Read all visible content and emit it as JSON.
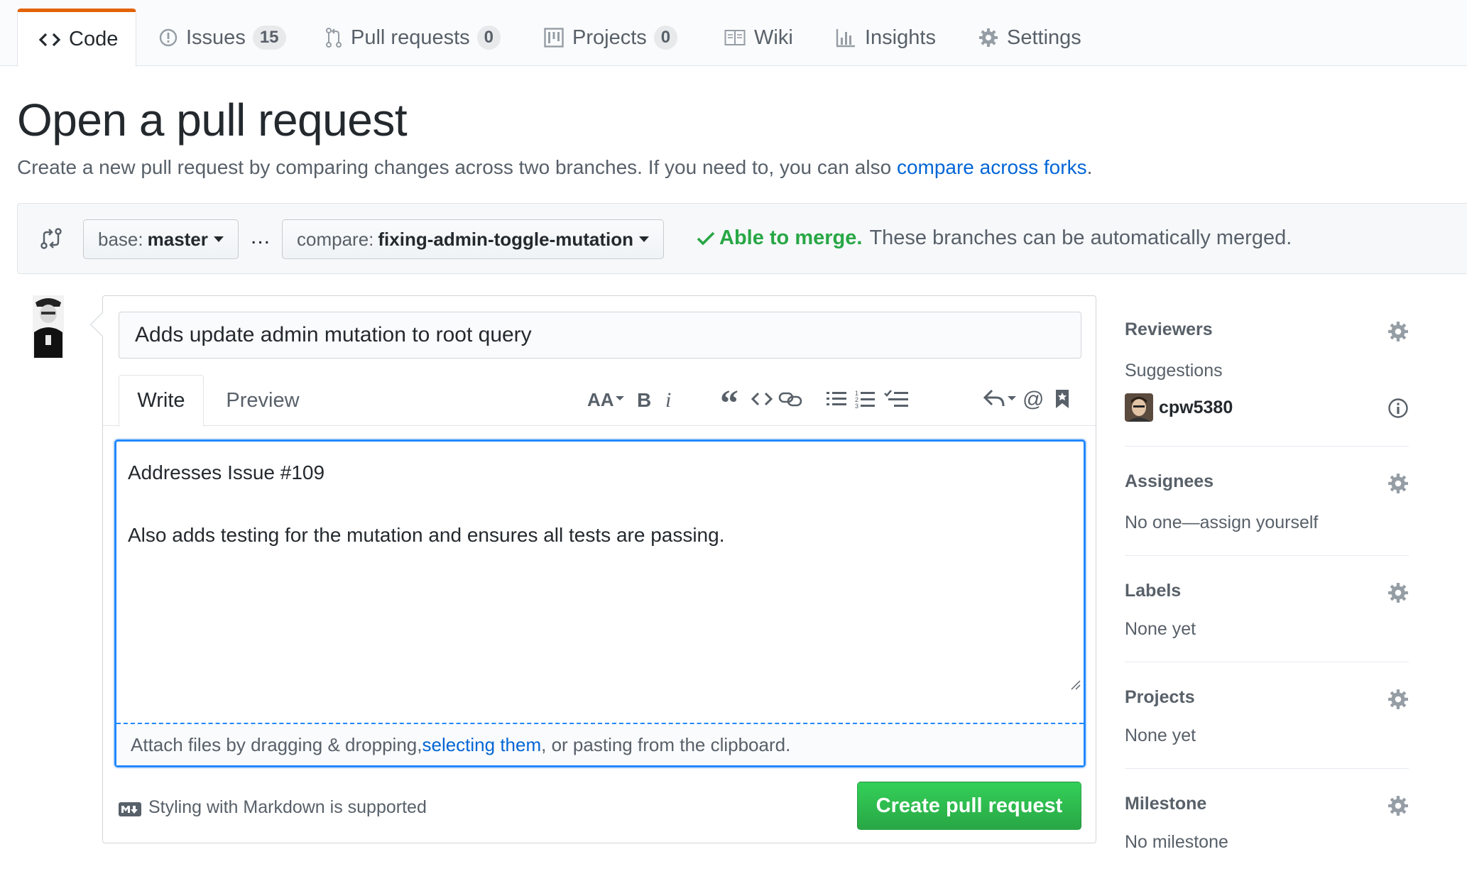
{
  "nav": {
    "tabs": [
      {
        "label": "Code"
      },
      {
        "label": "Issues",
        "count": "15"
      },
      {
        "label": "Pull requests",
        "count": "0"
      },
      {
        "label": "Projects",
        "count": "0"
      },
      {
        "label": "Wiki"
      },
      {
        "label": "Insights"
      },
      {
        "label": "Settings"
      }
    ],
    "selected_tab": "Code",
    "accent_color": "#e36209"
  },
  "header": {
    "title": "Open a pull request",
    "description": "Create a new pull request by comparing changes across two branches. If you need to, you can also",
    "compare_link": "compare across forks",
    "description_end": "."
  },
  "range": {
    "base_prefix": "base:",
    "base_branch": "master",
    "dots": "...",
    "compare_prefix": "compare:",
    "compare_branch": "fixing-admin-toggle-mutation",
    "merge_ok": "Able to merge.",
    "merge_text": "These branches can be automatically merged.",
    "ok_color": "#28a745"
  },
  "form": {
    "title_value": "Adds update admin mutation to root query",
    "tabs": {
      "write": "Write",
      "preview": "Preview"
    },
    "toolbar": [
      "header",
      "bold",
      "italic",
      "quote",
      "code",
      "link",
      "unordered-list",
      "ordered-list",
      "task-list",
      "reply",
      "mention",
      "saved-reply"
    ],
    "body_line1": "Addresses Issue #109",
    "body_line2": "Also adds testing for the mutation and ensures all tests are passing.",
    "attach_text_1": "Attach files by dragging & dropping, ",
    "attach_link": "selecting them",
    "attach_text_2": ", or pasting from the clipboard.",
    "markdown_note": "Styling with Markdown is supported",
    "submit_label": "Create pull request",
    "submit_color": "#28a745"
  },
  "sidebar": {
    "reviewers": {
      "heading": "Reviewers",
      "suggestions_label": "Suggestions",
      "suggested_user": "cpw5380"
    },
    "assignees": {
      "heading": "Assignees",
      "text": "No one—assign yourself"
    },
    "labels": {
      "heading": "Labels",
      "text": "None yet"
    },
    "projects": {
      "heading": "Projects",
      "text": "None yet"
    },
    "milestone": {
      "heading": "Milestone",
      "text": "No milestone"
    }
  }
}
